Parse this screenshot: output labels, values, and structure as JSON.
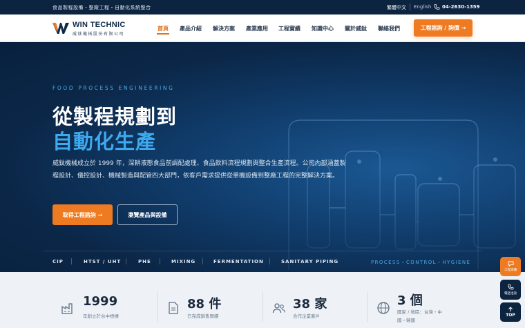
{
  "topbar": {
    "tagline": "食品製程設備・整廠工程・自動化系統整合",
    "lang_zh": "繁體中文",
    "lang_en": "English",
    "phone": "04-2630-1359",
    "phone_icon": "phone-icon"
  },
  "header": {
    "brand": "WIN TECHNIC",
    "brand_sub": "威鈦機械股份有限公司",
    "nav": [
      "首頁",
      "產品介紹",
      "解決方案",
      "產業應用",
      "工程實績",
      "知識中心",
      "關於威鈦",
      "聯絡我們"
    ],
    "cta": "工程諮詢 / 詢價 →"
  },
  "hero": {
    "eyebrow": "FOOD PROCESS ENGINEERING",
    "title_line1": "從製程規劃到",
    "title_line2": "自動化生產",
    "description": "威鈦機械成立於 1999 年，深耕液態食品前調配處理、食品飲料流程規劃與整合生產流程。公司內部涵蓋製程設計、儀控設計、機械製造與配管四大部門，依客戶需求提供從單機設備到整廠工程的完整解決方案。",
    "btn_primary": "取得工程諮詢 →",
    "btn_secondary": "瀏覽產品與設備",
    "tags": [
      "CIP",
      "HTST / UHT",
      "PHE",
      "MIXING",
      "FERMENTATION",
      "SANITARY PIPING"
    ],
    "tagline_right": "PROCESS・CONTROL・HYGIENE",
    "colors": {
      "accent": "#ee7b22",
      "highlight": "#3da9ee",
      "navy": "#0d2440"
    }
  },
  "stats": [
    {
      "icon": "factory-icon",
      "value": "1999",
      "label": "年創立於台中梧棲"
    },
    {
      "icon": "document-icon",
      "value": "88 件",
      "label": "已完成銷售實績"
    },
    {
      "icon": "users-icon",
      "value": "38 家",
      "label": "合作企業客戶"
    },
    {
      "icon": "globe-icon",
      "value": "3 個",
      "label": "國家 / 地區：台灣・中國・韓國"
    }
  ],
  "floating": {
    "quote_label": "工程詢價",
    "phone_label": "電話洽詢",
    "top_label": "TOP"
  }
}
